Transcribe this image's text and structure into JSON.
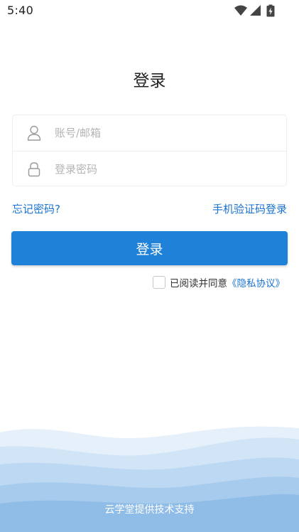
{
  "status_bar": {
    "time": "5:40",
    "icons": [
      "wifi-icon",
      "signal-icon",
      "battery-charging-icon"
    ]
  },
  "page": {
    "title": "登录"
  },
  "form": {
    "account_placeholder": "账号/邮箱",
    "account_value": "",
    "password_placeholder": "登录密码",
    "password_value": ""
  },
  "links": {
    "forgot_password": "忘记密码?",
    "sms_login": "手机验证码登录"
  },
  "login_button": {
    "label": "登录"
  },
  "agreement": {
    "checked": false,
    "text": "已阅读并同意",
    "privacy_link": "《隐私协议》"
  },
  "footer": {
    "text": "云学堂提供技术支持"
  },
  "colors": {
    "accent": "#1f82d8",
    "link": "#1a73d0",
    "wave_light": "#dcebf9",
    "wave_mid": "#bcd8f1",
    "wave_dark": "#8fbee8"
  }
}
